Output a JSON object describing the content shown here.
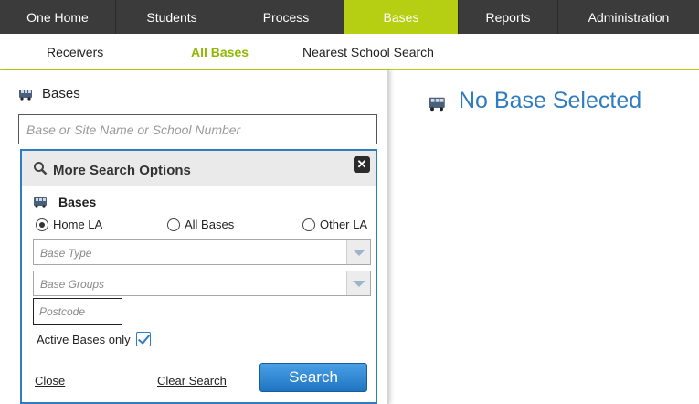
{
  "topnav": {
    "tabs": [
      {
        "label": "One Home",
        "active": false
      },
      {
        "label": "Students",
        "active": false
      },
      {
        "label": "Process",
        "active": false
      },
      {
        "label": "Bases",
        "active": true
      },
      {
        "label": "Reports",
        "active": false
      },
      {
        "label": "Administration",
        "active": false
      }
    ]
  },
  "subnav": {
    "tabs": [
      {
        "label": "Receivers",
        "active": false
      },
      {
        "label": "All Bases",
        "active": true
      },
      {
        "label": "Nearest School Search",
        "active": false
      }
    ]
  },
  "panel": {
    "heading": "Bases",
    "heading_icon": "bus-icon",
    "search_placeholder": "Base or Site Name or School Number",
    "more_options": {
      "title": "More Search Options",
      "title_icon": "magnifier-icon",
      "close_icon": "close-icon",
      "section_label": "Bases",
      "radios": [
        {
          "label": "Home LA",
          "checked": true
        },
        {
          "label": "All Bases",
          "checked": false
        },
        {
          "label": "Other LA",
          "checked": false
        }
      ],
      "base_type_placeholder": "Base Type",
      "base_groups_placeholder": "Base Groups",
      "postcode_placeholder": "Postcode",
      "active_only_label": "Active Bases only",
      "active_only_checked": true,
      "close_link": "Close",
      "clear_link": "Clear Search",
      "search_button": "Search"
    }
  },
  "main": {
    "title": "No Base Selected"
  },
  "colors": {
    "nav_bg": "#3b3b3b",
    "accent_green": "#b7cf12",
    "active_sub_green": "#8fb800",
    "brand_blue": "#2f7cc0"
  }
}
